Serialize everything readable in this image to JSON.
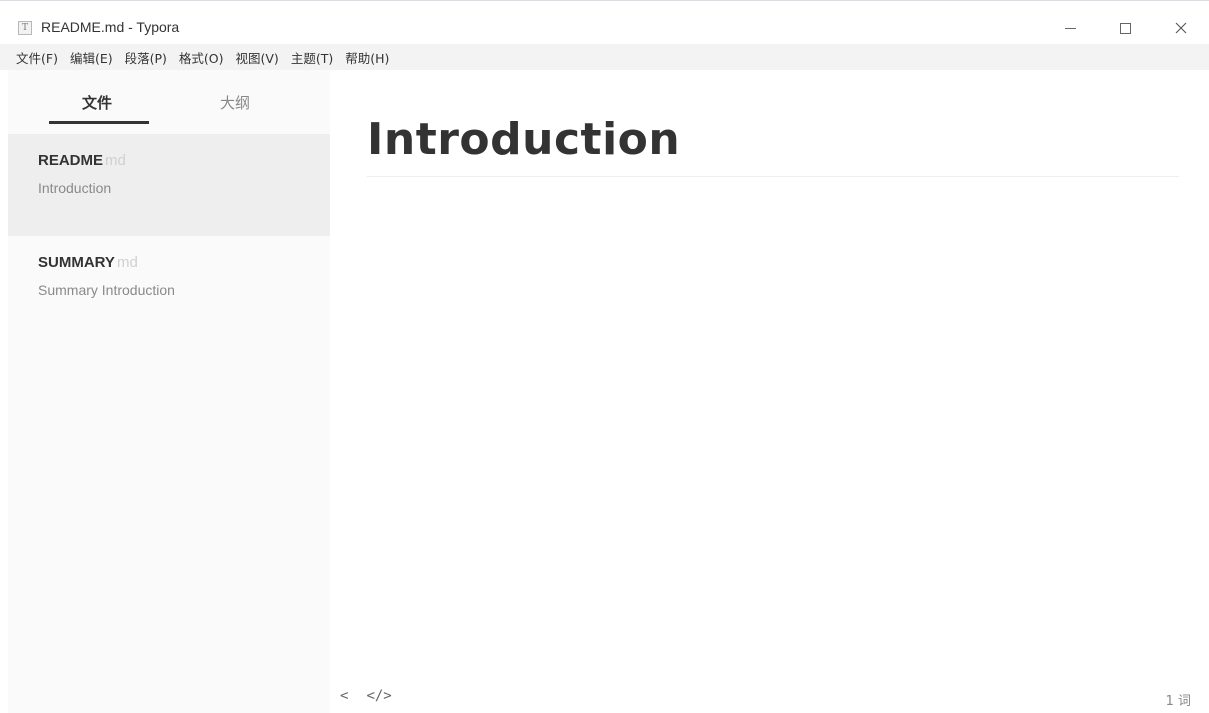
{
  "window": {
    "app_icon_glyph": "T",
    "title": "README.md - Typora"
  },
  "menu": [
    {
      "label": "文件(F)"
    },
    {
      "label": "编辑(E)"
    },
    {
      "label": "段落(P)"
    },
    {
      "label": "格式(O)"
    },
    {
      "label": "视图(V)"
    },
    {
      "label": "主题(T)"
    },
    {
      "label": "帮助(H)"
    }
  ],
  "sidebar": {
    "tabs": {
      "files": "文件",
      "outline": "大纲"
    },
    "files": [
      {
        "name": "README",
        "ext": "md",
        "desc": "Introduction",
        "active": true
      },
      {
        "name": "SUMMARY",
        "ext": "md",
        "desc": "Summary Introduction",
        "active": false
      }
    ]
  },
  "editor": {
    "heading": "Introduction"
  },
  "statusbar": {
    "sidebar_toggle_glyph": "<",
    "source_mode_glyph": "</>",
    "word_count": "1 词"
  },
  "colors": {
    "menubar_bg": "#f3f3f3",
    "sidebar_bg": "#fafafa",
    "active_file_bg": "#eeeeee",
    "text": "#333333"
  }
}
